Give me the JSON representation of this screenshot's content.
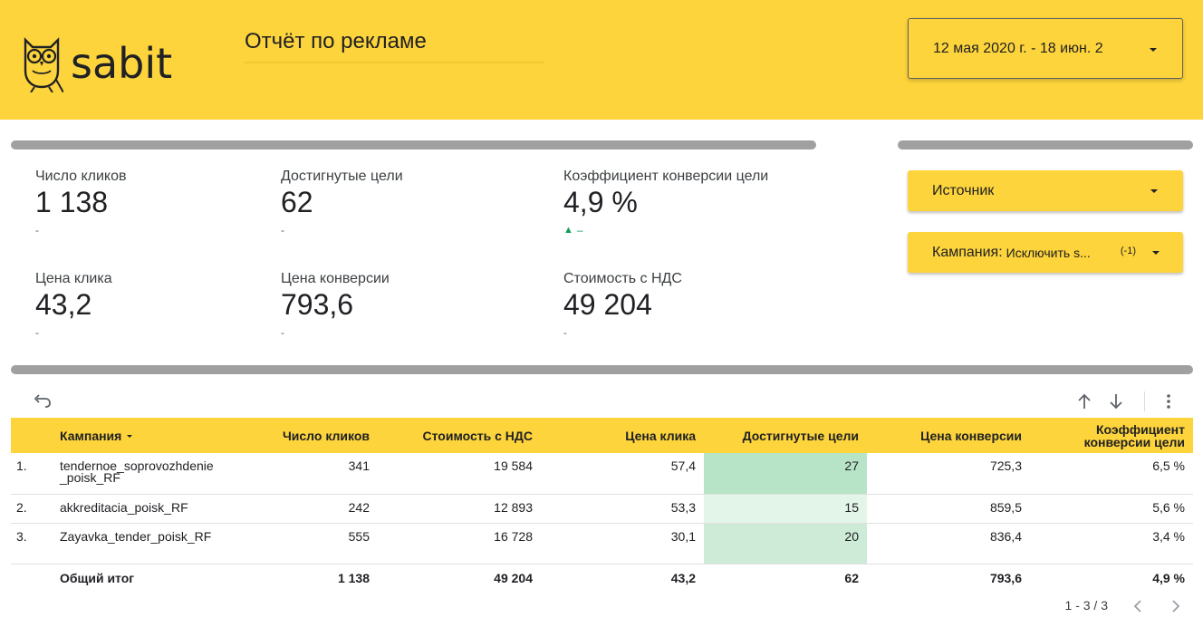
{
  "header": {
    "logo_text": "sabit",
    "report_title": "Отчёт по рекламе",
    "date_range": "12 мая 2020 г. - 18 июн. 2"
  },
  "kpis": [
    {
      "label": "Число кликов",
      "value": "1 138",
      "delta": "-"
    },
    {
      "label": "Достигнутые цели",
      "value": "62",
      "delta": "-"
    },
    {
      "label": "Коэффициент конверсии цели",
      "value": "4,9 %",
      "delta": "–"
    },
    {
      "label": "Цена клика",
      "value": "43,2",
      "delta": "-"
    },
    {
      "label": "Цена конверсии",
      "value": "793,6",
      "delta": "-"
    },
    {
      "label": "Стоимость с НДС",
      "value": "49 204",
      "delta": "-"
    }
  ],
  "filters": {
    "source_label": "Источник",
    "campaign_label": "Кампания:",
    "campaign_value": "Исключить s...",
    "campaign_count": "(-1)"
  },
  "table": {
    "columns": [
      "Кампания",
      "Число кликов",
      "Стоимость с НДС",
      "Цена клика",
      "Достигнутые цели",
      "Цена конверсии",
      "Коэффициент конверсии цели"
    ],
    "rows": [
      {
        "idx": "1.",
        "campaign": "tendernoe_soprovozhdenie_poisk_RF",
        "clicks": "341",
        "cost": "19 584",
        "cpc": "57,4",
        "goals": "27",
        "cpa": "725,3",
        "cr": "6,5 %",
        "heat": "#b7e4c7"
      },
      {
        "idx": "2.",
        "campaign": "akkreditacia_poisk_RF",
        "clicks": "242",
        "cost": "12 893",
        "cpc": "53,3",
        "goals": "15",
        "cpa": "859,5",
        "cr": "5,6 %",
        "heat": "#e3f4e8"
      },
      {
        "idx": "3.",
        "campaign": "Zayavka_tender_poisk_RF",
        "clicks": "555",
        "cost": "16 728",
        "cpc": "30,1",
        "goals": "20",
        "cpa": "836,4",
        "cr": "3,4 %",
        "heat": "#cdebd7"
      }
    ],
    "total": {
      "label": "Общий итог",
      "clicks": "1 138",
      "cost": "49 204",
      "cpc": "43,2",
      "goals": "62",
      "cpa": "793,6",
      "cr": "4,9 %"
    }
  },
  "pagination": {
    "text": "1 - 3 / 3"
  },
  "colors": {
    "brand": "#fdd43b",
    "divider": "#a0a0a0",
    "positive": "#0f9d58"
  },
  "icons": {
    "reset": "undo-icon",
    "sort_asc": "arrow-up-icon",
    "sort_desc": "arrow-down-icon",
    "more": "more-vert-icon",
    "prev": "chevron-left-icon",
    "next": "chevron-right-icon"
  }
}
